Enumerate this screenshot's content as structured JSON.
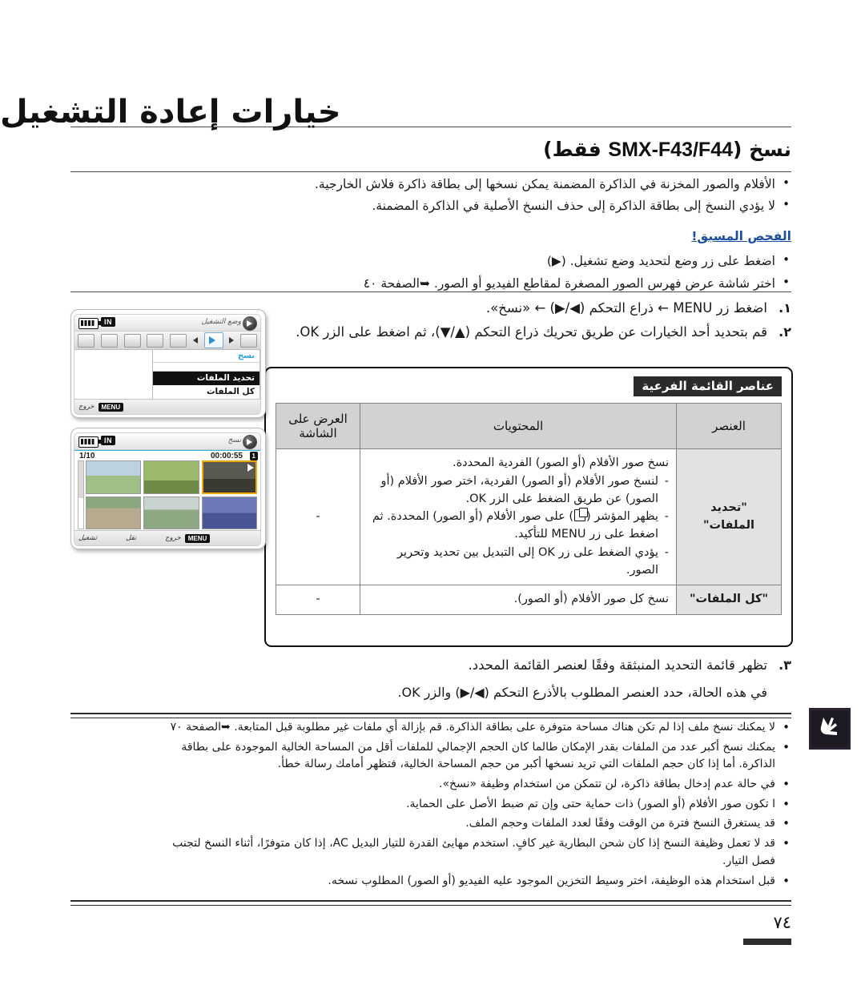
{
  "chapter": {
    "title": "خيارات إعادة التشغيل"
  },
  "section": {
    "title_ar_lead": "نسخ (",
    "title_lat": "SMX-F43/F44",
    "title_ar_tail": " فقط)"
  },
  "intro_bullets": [
    "الأفلام والصور المخزنة في الذاكرة المضمنة يمكن نسخها إلى بطاقة ذاكرة فلاش الخارجية.",
    "لا يؤدي النسخ إلى بطاقة الذاكرة إلى حذف النسخ الأصلية في الذاكرة المضمنة."
  ],
  "precheck_heading": "الفحص المسبق!",
  "prereq_bullets": [
    "اضغط على زر وضع لتحديد وضع تشغيل. (▶)",
    "اختر شاشة عرض فهرس الصور المصغرة لمقاطع الفيديو أو الصور. ➥الصفحة ٤٠"
  ],
  "steps_top": [
    {
      "num": "١.",
      "text": "اضغط زر MENU ← ذراع التحكم (◀/▶) ← «نسخ»."
    },
    {
      "num": "٢.",
      "text": "قم بتحديد أحد الخيارات عن طريق تحريك ذراع التحكم (▲/▼)، ثم اضغط على الزر OK."
    }
  ],
  "submenu_table": {
    "caption": "عناصر القائمة الفرعية",
    "headers": {
      "item": "العنصر",
      "contents": "المحتويات",
      "screen": "العرض على الشاشة"
    },
    "rows": [
      {
        "item": "\"تحديد الملفات\"",
        "lead": "نسخ صور الأفلام (أو الصور) الفردية المحددة.",
        "dashes": [
          "لنسخ صور الأفلام (أو الصور) الفردية، اختر صور الأفلام (أو الصور) عن طريق الضغط على الزر OK.",
          "يظهر المؤشر ( ) على صور الأفلام (أو الصور) المحددة. ثم اضغط على زر MENU للتأكيد.",
          "يؤدي الضغط على زر OK إلى التبديل بين تحديد وتحرير الصور."
        ],
        "screen": "-"
      },
      {
        "item": "\"كل الملفات\"",
        "lead": "نسخ كل صور الأفلام (أو الصور).",
        "dashes": [],
        "screen": "-"
      }
    ]
  },
  "steps_bottom": {
    "num": "٣.",
    "text": "تظهر قائمة التحديد المنبثقة وفقًا لعنصر القائمة المحدد.",
    "sub": "في هذه الحالة، حدد العنصر المطلوب بالأذرع التحكم (◀/▶) والزر OK."
  },
  "notes": [
    "لا يمكنك نسخ ملف إذا لم تكن هناك مساحة متوفرة على بطاقة الذاكرة. قم بإزالة أي ملفات غير مطلوبة قبل المتابعة. ➥الصفحة ٧٠",
    "يمكنك نسخ أكبر عدد من الملفات بقدر الإمكان طالما كان الحجم الإجمالي للملفات أقل من المساحة الخالية الموجودة على بطاقة الذاكرة. أما إذا كان حجم الملفات التي تريد نسخها أكبر من حجم المساحة الخالية، فتظهر أمامك رسالة خطأ.",
    "في حالة عدم إدخال بطاقة ذاكرة، لن تتمكن من استخدام وظيفة «نسخ».",
    "ا تكون صور الأفلام (أو الصور) ذات حماية حتى وإن تم ضبط الأصل على الحماية.",
    "قد يستغرق النسخ فترة من الوقت وفقًا لعدد الملفات وحجم الملف.",
    "قد لا تعمل وظيفة النسخ إذا كان شحن البطارية غير كافٍ. استخدم مهايئ القدرة للتيار البديل AC، إذا كان متوفرًا، أثناء النسخ لتجنب فصل التيار.",
    "قبل استخدام هذه الوظيفة، اختر وسيط التخزين الموجود عليه الفيديو (أو الصور) المطلوب نسخه."
  ],
  "folio": "٧٤",
  "lcd_menu": {
    "in_badge": "IN",
    "scribble": "وضع التشغيل",
    "menu_title": "نسخ",
    "rows": [
      {
        "label": "تحديد الملفات",
        "active": true
      },
      {
        "label": "كل الملفات",
        "active": false
      }
    ],
    "foot_label": "خروج",
    "menu_button": "MENU"
  },
  "lcd_thumbs": {
    "in_badge": "IN",
    "counter": "1/10",
    "duration": "00:00:55",
    "card_badge": "1",
    "scribble": "نسخ",
    "foot_play": "تشغيل",
    "foot_move": "نقل",
    "foot_exit": "خروج",
    "menu_button": "MENU"
  },
  "icons": {
    "battery": "battery-icon",
    "play": "play-mode-icon",
    "copy_tab": "copy-tab-icon",
    "note": "note-hand-icon",
    "file_marker": "file-marker-icon"
  },
  "colors": {
    "precheck_blue": "#1a4fa0",
    "menu_accent": "#29a3e0",
    "selection_orange": "#f0a800",
    "caption_bg": "#2b2b2b"
  }
}
